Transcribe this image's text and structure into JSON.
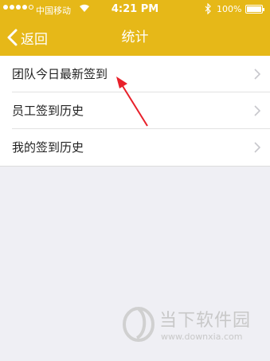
{
  "status_bar": {
    "carrier": "中国移动",
    "time": "4:21 PM",
    "battery": "100%"
  },
  "nav": {
    "back_label": "返回",
    "title": "统计"
  },
  "list": {
    "items": [
      {
        "label": "团队今日最新签到"
      },
      {
        "label": "员工签到历史"
      },
      {
        "label": "我的签到历史"
      }
    ]
  },
  "watermark": {
    "name": "当下软件园",
    "url": "www.downxia.com"
  },
  "colors": {
    "accent": "#e6b818",
    "arrow": "#e8202a",
    "background": "#efeff4"
  }
}
